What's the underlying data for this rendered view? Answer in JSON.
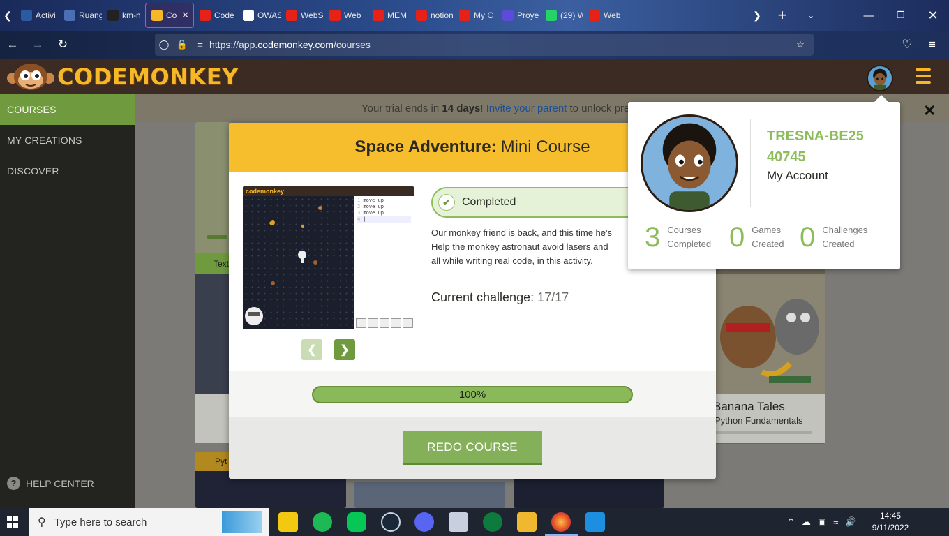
{
  "browser": {
    "tabs": [
      {
        "label": "Activi",
        "icon": "bars-icon",
        "color": "#2b5aa0"
      },
      {
        "label": "Ruang",
        "icon": "ruangguru-icon",
        "color": "#4a6fb5"
      },
      {
        "label": "km-n",
        "icon": "github-icon",
        "color": "#222222"
      },
      {
        "label": "Co",
        "icon": "banana-icon",
        "color": "#f6b826",
        "active": true
      },
      {
        "label": "Code",
        "icon": "youtube-icon",
        "color": "#e62117"
      },
      {
        "label": "OWAS",
        "icon": "owasp-icon",
        "color": "#ffffff"
      },
      {
        "label": "WebS",
        "icon": "youtube-icon",
        "color": "#e62117"
      },
      {
        "label": "Web",
        "icon": "youtube-icon",
        "color": "#e62117"
      },
      {
        "label": "MEM",
        "icon": "youtube-icon",
        "color": "#e62117"
      },
      {
        "label": "notion",
        "icon": "youtube-icon",
        "color": "#e62117"
      },
      {
        "label": "My C",
        "icon": "youtube-icon",
        "color": "#e62117"
      },
      {
        "label": "Proye",
        "icon": "canva-icon",
        "color": "#5b4bd8"
      },
      {
        "label": "(29) W",
        "icon": "whatsapp-icon",
        "color": "#25d366"
      },
      {
        "label": "Web",
        "icon": "youtube-icon",
        "color": "#e62117"
      }
    ],
    "whatsapp_count": "29",
    "url_prefix": "https://app.",
    "url_host": "codemonkey.com",
    "url_path": "/courses"
  },
  "app": {
    "logo_text": "CODEMONKEY",
    "sidebar": [
      {
        "label": "COURSES",
        "active": true
      },
      {
        "label": "MY CREATIONS"
      },
      {
        "label": "DISCOVER"
      }
    ],
    "help_label": "HELP CENTER",
    "trial": {
      "prefix": "Your trial ends in",
      "days": "14 days",
      "excl": "!",
      "link": "Invite your parent",
      "suffix": "to unlock pre"
    },
    "bg_card_labels": {
      "tag_text": "Text",
      "tag_python": "Pyt",
      "banana_title": "Banana Tales",
      "banana_sub": "Python Fundamentals"
    }
  },
  "modal": {
    "title_bold": "Space Adventure:",
    "title_rest": "Mini Course",
    "thumb_logo": "codemonkey",
    "code_lines": [
      "move up",
      "move up",
      "move up"
    ],
    "completed_label": "Completed",
    "description": [
      "Our monkey friend is back, and this time he's",
      "Help the monkey astronaut avoid lasers and",
      "all while writing real code, in this activity."
    ],
    "challenge_label": "Current challenge:",
    "challenge_value": "17/17",
    "progress_text": "100%",
    "progress_fraction": 1.0,
    "redo_label": "REDO COURSE"
  },
  "account": {
    "username": "TRESNA-BE2540745",
    "my_account": "My Account",
    "stats": [
      {
        "value": "3",
        "line1": "Courses",
        "line2": "Completed"
      },
      {
        "value": "0",
        "line1": "Games",
        "line2": "Created"
      },
      {
        "value": "0",
        "line1": "Challenges",
        "line2": "Created"
      }
    ],
    "close": "✕"
  },
  "taskbar": {
    "search_placeholder": "Type here to search",
    "time": "14:45",
    "date": "9/11/2022",
    "apps": [
      "sticky-notes-icon",
      "spotify-icon",
      "line-icon",
      "steam-icon",
      "discord-icon",
      "editor-icon",
      "shield-app-icon",
      "file-explorer-icon",
      "firefox-icon",
      "vscode-icon"
    ]
  },
  "colors": {
    "brand_orange": "#f6bd2c",
    "brand_green": "#8cbd5a",
    "header_brown": "#3b2b22",
    "sidebar_dark": "#23241f"
  }
}
